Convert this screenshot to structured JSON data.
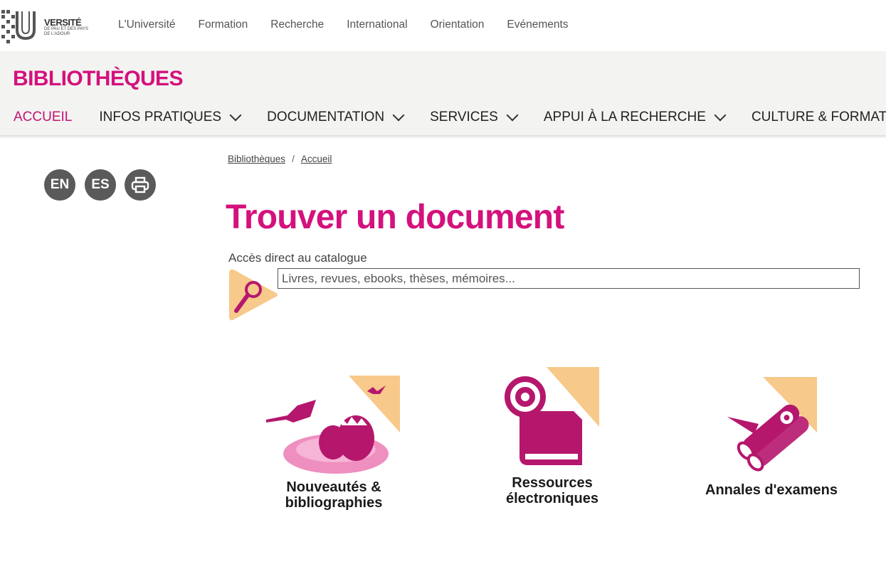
{
  "header": {
    "logo_name": "VERSITÉ",
    "logo_sub": "DE PAU ET DES PAYS DE L'ADOUR",
    "top_nav": [
      "L'Université",
      "Formation",
      "Recherche",
      "International",
      "Orientation",
      "Evénements"
    ]
  },
  "site": {
    "title": "BIBLIOTHÈQUES",
    "main_nav": [
      "ACCUEIL",
      "INFOS PRATIQUES",
      "DOCUMENTATION",
      "SERVICES",
      "APPUI À LA RECHERCHE",
      "CULTURE & FORMATION"
    ]
  },
  "sidebar": {
    "lang_en": "EN",
    "lang_es": "ES",
    "print_icon": "printer-icon"
  },
  "breadcrumb": {
    "home": "Bibliothèques",
    "current": "Accueil"
  },
  "main": {
    "title": "Trouver un document",
    "catalog_label": "Accès direct au catalogue",
    "search_placeholder": "Livres, revues, ebooks, thèses, mémoires...",
    "tiles": [
      {
        "line1": "Nouveautés &",
        "line2": "bibliographies",
        "icon": "nest-eggs-icon"
      },
      {
        "line1": "Ressources",
        "line2": "électroniques",
        "icon": "email-book-icon"
      },
      {
        "line1": "Annales d'examens",
        "line2": "",
        "icon": "rolled-papers-icon"
      }
    ]
  },
  "colors": {
    "brand": "#d4117d",
    "accent": "#f7c98a",
    "icon_fill": "#b5176d"
  }
}
